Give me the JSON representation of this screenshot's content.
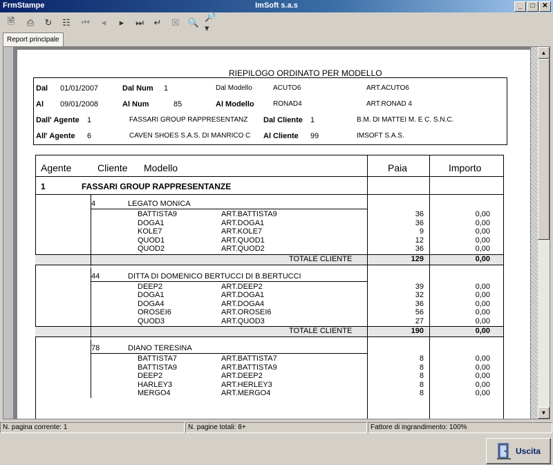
{
  "window": {
    "form_name": "FrmStampe",
    "title": "ImSoft s.a.s",
    "min": "_",
    "max": "□",
    "close": "✕"
  },
  "tabs": [
    {
      "label": "Report principale"
    }
  ],
  "report": {
    "title": "RIEPILOGO ORDINATO PER MODELLO",
    "filters": {
      "dal_label": "Dal",
      "dal_value": "01/01/2007",
      "al_label": "Al",
      "al_value": "09/01/2008",
      "dal_num_label": "Dal Num",
      "dal_num_value": "1",
      "al_num_label": "Al Num",
      "al_num_value": "85",
      "dal_modello_label": "Dal Modello",
      "dal_modello_code": "ACUTO6",
      "dal_modello_desc": "ART.ACUTO6",
      "al_modello_label": "Al Modello",
      "al_modello_code": "RONAD4",
      "al_modello_desc": "ART.RONAD 4",
      "dall_agente_label": "Dall' Agente",
      "dall_agente_code": "1",
      "dall_agente_name": "FASSARI GROUP RAPPRESENTANZ",
      "all_agente_label": "All' Agente",
      "all_agente_code": "6",
      "all_agente_name": "CAVEN SHOES S.A.S. DI MANRICO C",
      "dal_cliente_label": "Dal Cliente",
      "dal_cliente_code": "1",
      "dal_cliente_name": "B.M. DI MATTEI M. E C. S.N.C.",
      "al_cliente_label": "Al Cliente",
      "al_cliente_code": "99",
      "al_cliente_name": "IMSOFT S.A.S."
    },
    "columns": {
      "agente": "Agente",
      "cliente": "Cliente",
      "modello": "Modello",
      "paia": "Paia",
      "importo": "Importo"
    },
    "agent": {
      "code": "1",
      "name": "FASSARI GROUP RAPPRESENTANZE"
    },
    "total_label": "TOTALE CLIENTE",
    "clients": [
      {
        "code": "4",
        "name": "LEGATO MONICA",
        "rows": [
          {
            "model": "BATTISTA9",
            "desc": "ART.BATTISTA9",
            "paia": "36",
            "importo": "0,00"
          },
          {
            "model": "DOGA1",
            "desc": "ART.DOGA1",
            "paia": "36",
            "importo": "0,00"
          },
          {
            "model": "KOLE7",
            "desc": "ART.KOLE7",
            "paia": "9",
            "importo": "0,00"
          },
          {
            "model": "QUOD1",
            "desc": "ART.QUOD1",
            "paia": "12",
            "importo": "0,00"
          },
          {
            "model": "QUOD2",
            "desc": "ART.QUOD2",
            "paia": "36",
            "importo": "0,00"
          }
        ],
        "total_paia": "129",
        "total_importo": "0,00"
      },
      {
        "code": "44",
        "name": "DITTA DI DOMENICO BERTUCCI DI B.BERTUCCI",
        "rows": [
          {
            "model": "DEEP2",
            "desc": "ART.DEEP2",
            "paia": "39",
            "importo": "0,00"
          },
          {
            "model": "DOGA1",
            "desc": "ART.DOGA1",
            "paia": "32",
            "importo": "0,00"
          },
          {
            "model": "DOGA4",
            "desc": "ART.DOGA4",
            "paia": "36",
            "importo": "0,00"
          },
          {
            "model": "OROSEI6",
            "desc": "ART.OROSEI6",
            "paia": "56",
            "importo": "0,00"
          },
          {
            "model": "QUOD3",
            "desc": "ART.QUOD3",
            "paia": "27",
            "importo": "0,00"
          }
        ],
        "total_paia": "190",
        "total_importo": "0,00"
      },
      {
        "code": "78",
        "name": "DIANO TERESINA",
        "rows": [
          {
            "model": "BATTISTA7",
            "desc": "ART.BATTISTA7",
            "paia": "8",
            "importo": "0,00"
          },
          {
            "model": "BATTISTA9",
            "desc": "ART.BATTISTA9",
            "paia": "8",
            "importo": "0,00"
          },
          {
            "model": "DEEP2",
            "desc": "ART.DEEP2",
            "paia": "8",
            "importo": "0,00"
          },
          {
            "model": "HARLEY3",
            "desc": "ART.HERLEY3",
            "paia": "8",
            "importo": "0,00"
          },
          {
            "model": "MERGO4",
            "desc": "ART.MERGO4",
            "paia": "8",
            "importo": "0,00"
          }
        ]
      }
    ]
  },
  "status": {
    "current_page": "N. pagina corrente: 1",
    "total_pages": "N. pagine totali: 8+",
    "zoom": "Fattore di ingrandimento: 100%"
  },
  "exit_button": {
    "label": "Uscita"
  },
  "toolbar_icons": [
    "export-icon",
    "print-icon",
    "refresh-icon",
    "tree-icon",
    "first-page-icon",
    "prev-page-icon",
    "next-page-icon",
    "last-page-icon",
    "goto-page-icon",
    "stop-icon",
    "search-icon",
    "zoom-icon"
  ]
}
